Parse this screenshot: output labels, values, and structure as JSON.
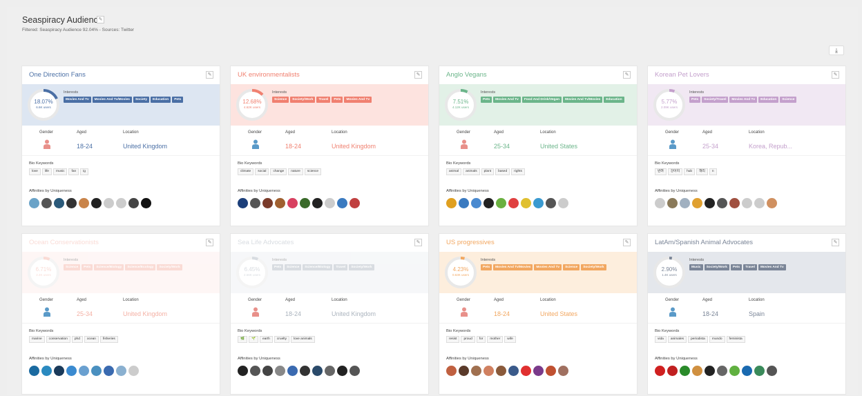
{
  "header": {
    "title": "Seaspiracy Audience",
    "subtitle": "Filtered: Seaspiracy Audience 92.04% - Sources: Twitter"
  },
  "labels": {
    "interests": "Interests",
    "gender": "Gender",
    "aged": "Aged",
    "location": "Location",
    "bio_keywords": "Bio Keywords",
    "affinities": "Affinities by Uniqueness"
  },
  "cards": [
    {
      "title": "One Direction Fans",
      "color": "#4a6fa5",
      "band": "#dde6f2",
      "pct_value": 18.07,
      "pct": "18.07%",
      "users": "6.6K users",
      "tags": [
        "Movies And Tv",
        "Movies And Tv/Movies",
        "Society",
        "Education",
        "Pets"
      ],
      "gender": "female",
      "age": "18-24",
      "location": "United Kingdom",
      "keywords": [
        "love",
        "life",
        "music",
        "fan",
        "ig"
      ],
      "avatars": [
        "#6aa3c8",
        "#555",
        "#2b5a7a",
        "#333",
        "#c9844a",
        "#222",
        "#ccc",
        "#ccc",
        "#444",
        "#111"
      ]
    },
    {
      "title": "UK environmentalists",
      "color": "#f08070",
      "band": "#fde3df",
      "pct_value": 12.68,
      "pct": "12.68%",
      "users": "4.62K users",
      "tags": [
        "Science",
        "Society/Work",
        "Travel",
        "Pets",
        "Movies And Tv"
      ],
      "gender": "male",
      "age": "18-24",
      "location": "United Kingdom",
      "keywords": [
        "climate",
        "social",
        "change",
        "nature",
        "science"
      ],
      "avatars": [
        "#1c3f7a",
        "#555",
        "#7a3b2a",
        "#a06030",
        "#d84060",
        "#3a6a2a",
        "#222",
        "#ccc",
        "#3a7ac0",
        "#c04040"
      ]
    },
    {
      "title": "Anglo Vegans",
      "color": "#6bb58a",
      "band": "#e2f1e7",
      "pct_value": 7.51,
      "pct": "7.51%",
      "users": "4.12K users",
      "tags": [
        "Pets",
        "Movies And Tv",
        "Food And Drink/Vegan",
        "Movies And Tv/Movies",
        "Education"
      ],
      "gender": "female",
      "age": "25-34",
      "location": "United States",
      "keywords": [
        "animal",
        "animals",
        "plant",
        "based",
        "rights"
      ],
      "avatars": [
        "#e0a020",
        "#3a7ac0",
        "#4a8ad0",
        "#222",
        "#6ab040",
        "#e04040",
        "#e0c030",
        "#3a9ad0",
        "#555",
        "#ccc"
      ]
    },
    {
      "title": "Korean Pet Lovers",
      "color": "#c4a0cc",
      "band": "#f1e8f3",
      "pct_value": 5.77,
      "pct": "5.77%",
      "users": "2.09K users",
      "tags": [
        "Pets",
        "Society/Travel",
        "Movies And Tv",
        "Education",
        "Science"
      ],
      "gender": "male",
      "age": "25-34",
      "location": "Korea, Repub...",
      "keywords": [
        "반려",
        "강아지",
        "hub",
        "해리",
        "n"
      ],
      "avatars": [
        "#ccc",
        "#8a7a5a",
        "#a0b0c0",
        "#e0a030",
        "#222",
        "#555",
        "#a05040",
        "#ccc",
        "#ccc",
        "#d09060"
      ]
    },
    {
      "title": "Ocean Conservationists",
      "color": "#f4b0a4",
      "band": "#fdecea",
      "pct_value": 6.71,
      "pct": "6.71%",
      "users": "2.4K users",
      "tags": [
        "Science",
        "Pets",
        "Science/Biology",
        "Science/Ecology",
        "Society/Work"
      ],
      "gender": "male",
      "age": "25-34",
      "location": "United Kingdom",
      "keywords": [
        "marine",
        "conservation",
        "phd",
        "ocean",
        "fisheries"
      ],
      "avatars": [
        "#1a6aa0",
        "#2a8ac0",
        "#1a3a5a",
        "#3a8ad0",
        "#6aa0d0",
        "#4a90c0",
        "#3a6ab0",
        "#8ab0d0",
        "#ccc"
      ]
    },
    {
      "title": "Sea Life Advocates",
      "color": "#aab3bd",
      "band": "#eceff2",
      "pct_value": 6.45,
      "pct": "6.45%",
      "users": "2.66K users",
      "tags": [
        "Pets",
        "Science",
        "Science/Biology",
        "Travel",
        "Society/Work"
      ],
      "gender": "female",
      "age": "18-24",
      "location": "United Kingdom",
      "keywords": [
        "🌿",
        "🌱",
        "earth",
        "cruelty",
        "love animals"
      ],
      "avatars": [
        "#222",
        "#555",
        "#444",
        "#888",
        "#3a6ab0",
        "#333",
        "#2a4a6a",
        "#666",
        "#222",
        "#555"
      ]
    },
    {
      "title": "US progressives",
      "color": "#f2a760",
      "band": "#fdeedd",
      "pct_value": 4.23,
      "pct": "4.23%",
      "users": "0.63K users",
      "tags": [
        "Pets",
        "Movies And Tv/Movies",
        "Movies And Tv",
        "Science",
        "Society/Work"
      ],
      "gender": "female",
      "age": "18-24",
      "location": "United States",
      "keywords": [
        "resist",
        "proud",
        "for",
        "mother",
        "wife"
      ],
      "avatars": [
        "#c06040",
        "#5a3a2a",
        "#a07050",
        "#d08060",
        "#8a5a3a",
        "#3a5a8a",
        "#e03030",
        "#7a3a8a",
        "#c05030",
        "#a07060"
      ]
    },
    {
      "title": "LatAm/Spanish Animal Advocates",
      "color": "#7a8597",
      "band": "#e4e7ec",
      "pct_value": 2.9,
      "pct": "2.90%",
      "users": "1.4K users",
      "tags": [
        "Music",
        "Society/Work",
        "Pets",
        "Travel",
        "Movies And Tv"
      ],
      "gender": "male",
      "age": "18-24",
      "location": "Spain",
      "keywords": [
        "vida",
        "animales",
        "periodista",
        "mundo",
        "feminista"
      ],
      "avatars": [
        "#d02020",
        "#c02020",
        "#2a8a2a",
        "#d09040",
        "#222",
        "#666",
        "#60b040",
        "#1a6ab0",
        "#3a8a5a",
        "#555"
      ]
    }
  ]
}
